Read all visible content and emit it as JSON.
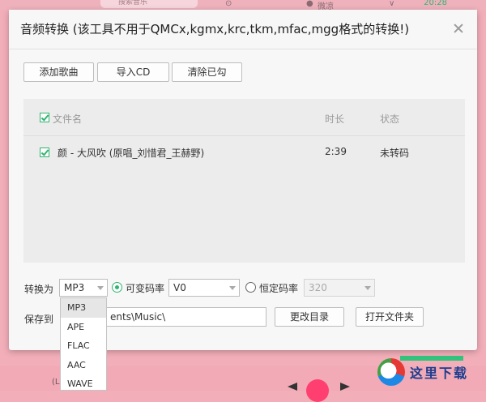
{
  "background": {
    "search_placeholder": "搜索音乐",
    "user_label": "微凉",
    "time_text": "20:28",
    "song_text": "(Live)",
    "watermark_text": "这里下载"
  },
  "dialog": {
    "title": "音频转换 (该工具不用于QMCx,kgmx,krc,tkm,mfac,mgg格式的转换!)",
    "close_icon": "close-icon"
  },
  "toolbar": {
    "add_song": "添加歌曲",
    "import_cd": "导入CD",
    "clear_checked": "清除已勾"
  },
  "file_list": {
    "columns": [
      "文件名",
      "时长",
      "状态"
    ],
    "rows": [
      {
        "name": "颜 - 大风吹 (原唱_刘惜君_王赫野)",
        "duration": "2:39",
        "status": "未转码",
        "checked": true
      }
    ]
  },
  "convert": {
    "label": "转换为",
    "format_value": "MP3",
    "vbr_label": "可变码率",
    "vbr_value": "V0",
    "cbr_label": "恒定码率",
    "cbr_value": "320"
  },
  "save": {
    "label": "保存到",
    "path_value": "ents\\Music\\",
    "change_dir": "更改目录",
    "open_folder": "打开文件夹"
  },
  "format_dropdown": {
    "options": [
      "MP3",
      "APE",
      "FLAC",
      "AAC",
      "WAVE"
    ],
    "selected": "MP3"
  },
  "colors": {
    "accent": "#31c27c",
    "check": "#2fb56f",
    "backdrop": "#f2aeb9"
  }
}
